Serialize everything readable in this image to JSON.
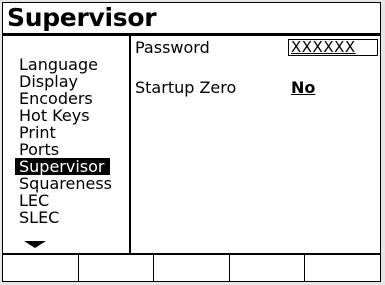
{
  "header": {
    "title": "Supervisor"
  },
  "sidebar": {
    "items": [
      {
        "label": "Language"
      },
      {
        "label": "Display"
      },
      {
        "label": "Encoders"
      },
      {
        "label": "Hot  Keys"
      },
      {
        "label": "Print"
      },
      {
        "label": "Ports"
      },
      {
        "label": "Supervisor",
        "selected": true
      },
      {
        "label": "Squareness"
      },
      {
        "label": "LEC"
      },
      {
        "label": "SLEC"
      }
    ],
    "more_icon": "down-arrow-icon"
  },
  "main": {
    "password_label": "Password",
    "password_value": "XXXXXX",
    "startup_zero_label": "Startup  Zero",
    "startup_zero_value": "No"
  },
  "softkeys": {
    "count": 5,
    "labels": [
      "",
      "",
      "",
      "",
      ""
    ]
  }
}
